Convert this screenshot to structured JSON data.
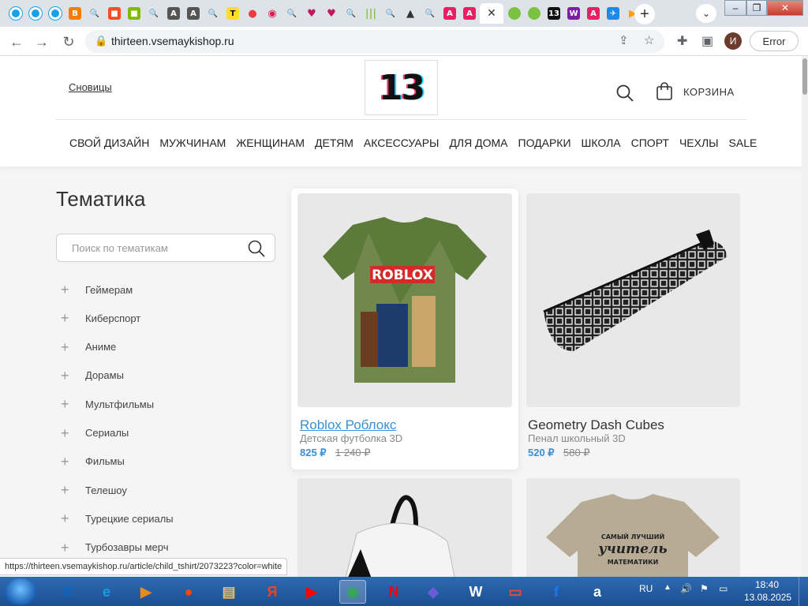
{
  "browser": {
    "tabs": [
      {
        "icon": "circle-icon",
        "color": "#1aa0e8",
        "glyph": ""
      },
      {
        "icon": "circle-icon",
        "color": "#1aa0e8",
        "glyph": ""
      },
      {
        "icon": "circle-icon",
        "color": "#1aa0e8",
        "glyph": ""
      },
      {
        "icon": "blogger-icon",
        "color": "#f57d00",
        "glyph": "B"
      },
      {
        "icon": "search-icon",
        "color": "#dee3ea",
        "glyph": "🔍"
      },
      {
        "icon": "windows-icon",
        "color": "#f25022",
        "glyph": "■"
      },
      {
        "icon": "windows-icon",
        "color": "#7fba00",
        "glyph": "■"
      },
      {
        "icon": "search-icon",
        "color": "#dee3ea",
        "glyph": "🔍"
      },
      {
        "icon": "a-icon",
        "color": "#555555",
        "glyph": "A"
      },
      {
        "icon": "a-icon",
        "color": "#555555",
        "glyph": "A"
      },
      {
        "icon": "search-icon",
        "color": "#dee3ea",
        "glyph": "🔍"
      },
      {
        "icon": "t-icon",
        "color": "#ffdd2d",
        "glyph": "T"
      },
      {
        "icon": "record-icon",
        "color": "#ef3b3b",
        "glyph": "●"
      },
      {
        "icon": "ring-icon",
        "color": "#d6214f",
        "glyph": "◉"
      },
      {
        "icon": "search-icon",
        "color": "#dee3ea",
        "glyph": "🔍"
      },
      {
        "icon": "heart-icon",
        "color": "#c2185b",
        "glyph": "♥"
      },
      {
        "icon": "heart-icon",
        "color": "#c2185b",
        "glyph": "♥"
      },
      {
        "icon": "search-icon",
        "color": "#dee3ea",
        "glyph": "🔍"
      },
      {
        "icon": "bars-icon",
        "color": "#8bc34a",
        "glyph": "|||"
      },
      {
        "icon": "search-icon",
        "color": "#dee3ea",
        "glyph": "🔍"
      },
      {
        "icon": "peak-icon",
        "color": "#333333",
        "glyph": "▲"
      },
      {
        "icon": "search-icon",
        "color": "#dee3ea",
        "glyph": "🔍"
      },
      {
        "icon": "a-icon",
        "color": "#e91e63",
        "glyph": "A"
      },
      {
        "icon": "a-icon",
        "color": "#e91e63",
        "glyph": "A"
      },
      {
        "icon": "close-icon",
        "color": "#ffffff",
        "glyph": "✕",
        "active": true
      },
      {
        "icon": "ball-icon",
        "color": "#7cc242",
        "glyph": ""
      },
      {
        "icon": "ball-icon",
        "color": "#7cc242",
        "glyph": ""
      },
      {
        "icon": "thirteen-icon",
        "color": "#111111",
        "glyph": "13"
      },
      {
        "icon": "w-icon",
        "color": "#7b1fa2",
        "glyph": "W"
      },
      {
        "icon": "a-icon",
        "color": "#e91e63",
        "glyph": "A"
      },
      {
        "icon": "plane-icon",
        "color": "#1e88e5",
        "glyph": "✈"
      },
      {
        "icon": "arrow-icon",
        "color": "#ffa000",
        "glyph": "▶"
      }
    ],
    "new_tab": "+",
    "url": "thirteen.vsemaykishop.ru",
    "profile_initial": "И",
    "error_label": "Error"
  },
  "site": {
    "city": "Сновицы",
    "logo_text": "13",
    "cart_label": "КОРЗИНА",
    "menu": [
      "СВОЙ ДИЗАЙН",
      "МУЖЧИНАМ",
      "ЖЕНЩИНАМ",
      "ДЕТЯМ",
      "АКСЕССУАРЫ",
      "ДЛЯ ДОМА",
      "ПОДАРКИ",
      "ШКОЛА",
      "СПОРТ",
      "ЧЕХЛЫ",
      "SALE"
    ]
  },
  "sidebar": {
    "title": "Тематика",
    "search_placeholder": "Поиск по тематикам",
    "categories": [
      "Геймерам",
      "Киберспорт",
      "Аниме",
      "Дорамы",
      "Мультфильмы",
      "Сериалы",
      "Фильмы",
      "Телешоу",
      "Турецкие сериалы",
      "Турбозавры мерч"
    ]
  },
  "products": [
    {
      "title": "Roblox Роблокс",
      "type": "Детская футболка 3D",
      "price": "825 ₽",
      "old_price": "1 240 ₽"
    },
    {
      "title": "Geometry Dash Cubes",
      "type": "Пенал школьный 3D",
      "price": "520 ₽",
      "old_price": "580 ₽"
    },
    {
      "title": "",
      "type": "",
      "price": "",
      "old_price": ""
    },
    {
      "title": "",
      "type": "",
      "price": "",
      "old_price": ""
    }
  ],
  "images": {
    "tshirt_text": "ROBLOX",
    "teacher_shirt_lines": [
      "САМЫЙ ЛУЧШИЙ",
      "учитель",
      "МАТЕМАТИКИ"
    ]
  },
  "status_url": "https://thirteen.vsemaykishop.ru/article/child_tshirt/2073223?color=white",
  "taskbar": {
    "apps": [
      {
        "name": "outlook",
        "glyph": "O",
        "color": "#0a64c8"
      },
      {
        "name": "ie",
        "glyph": "e",
        "color": "#1b9be0"
      },
      {
        "name": "media",
        "glyph": "▶",
        "color": "#e78b1c"
      },
      {
        "name": "reddit",
        "glyph": "●",
        "color": "#ff4500"
      },
      {
        "name": "explorer",
        "glyph": "▤",
        "color": "#e8c35a"
      },
      {
        "name": "yandex",
        "glyph": "Я",
        "color": "#fc3f1d"
      },
      {
        "name": "youtube",
        "glyph": "▶",
        "color": "#ff0000"
      },
      {
        "name": "chrome",
        "glyph": "◉",
        "color": "#34a853",
        "active": true
      },
      {
        "name": "netflix",
        "glyph": "N",
        "color": "#e50914"
      },
      {
        "name": "copilot",
        "glyph": "◆",
        "color": "#6a5cd6"
      },
      {
        "name": "wikipedia",
        "glyph": "W",
        "color": "#ffffff"
      },
      {
        "name": "shop",
        "glyph": "▭",
        "color": "#ee4d2d"
      },
      {
        "name": "facebook",
        "glyph": "f",
        "color": "#1877f2"
      },
      {
        "name": "amazon",
        "glyph": "a",
        "color": "#ffffff"
      }
    ],
    "lang": "RU",
    "time": "18:40",
    "date": "13.08.2025"
  }
}
